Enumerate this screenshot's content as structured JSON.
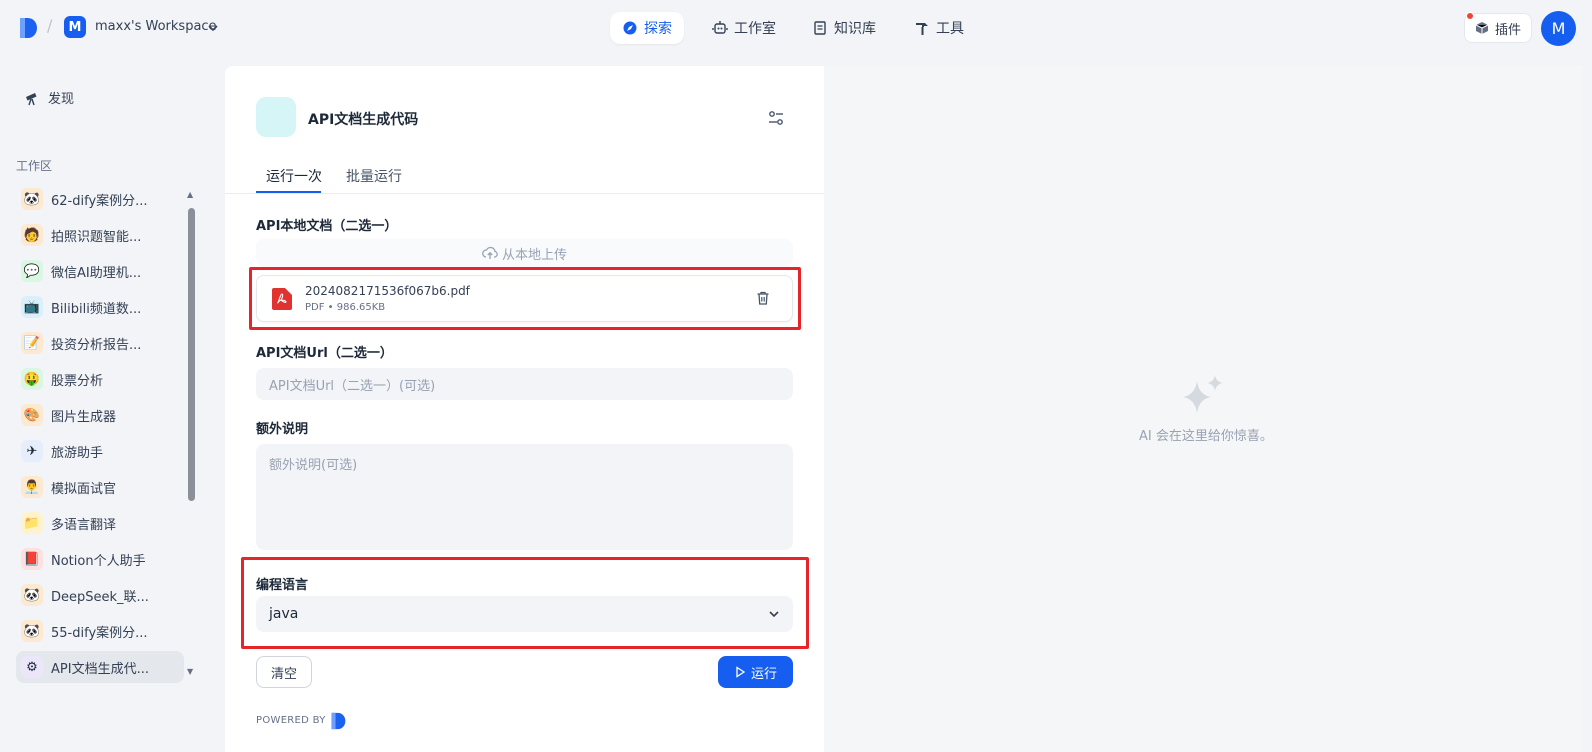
{
  "workspace": {
    "badge": "M",
    "name": "maxx's Workspace",
    "caret": "⌄"
  },
  "nav": {
    "explore": "探索",
    "studio": "工作室",
    "knowledge": "知识库",
    "tools": "工具"
  },
  "header": {
    "plugin_label": "插件",
    "avatar_initial": "M"
  },
  "sidebar": {
    "discover_label": "发现",
    "workspace_label": "工作区",
    "apps": [
      {
        "name": "62-dify案例分...",
        "icon": "panda-icon",
        "bg": "#fde8d0",
        "glyph": "🐼"
      },
      {
        "name": "拍照识题智能...",
        "icon": "student-icon",
        "bg": "#fde8d0",
        "glyph": "🧑"
      },
      {
        "name": "微信AI助理机...",
        "icon": "chat-icon",
        "bg": "#d9f7e1",
        "glyph": "💬"
      },
      {
        "name": "Bilibili频道数...",
        "icon": "tv-icon",
        "bg": "#d9f0fb",
        "glyph": "📺"
      },
      {
        "name": "投资分析报告...",
        "icon": "report-icon",
        "bg": "#fde8d0",
        "glyph": "📝"
      },
      {
        "name": "股票分析",
        "icon": "money-face-icon",
        "bg": "#d9f7e1",
        "glyph": "🤑"
      },
      {
        "name": "图片生成器",
        "icon": "palette-icon",
        "bg": "#fde8d0",
        "glyph": "🎨"
      },
      {
        "name": "旅游助手",
        "icon": "airplane-icon",
        "bg": "#e6eefb",
        "glyph": "✈"
      },
      {
        "name": "模拟面试官",
        "icon": "interview-icon",
        "bg": "#fde8d0",
        "glyph": "👨‍💼"
      },
      {
        "name": "多语言翻译",
        "icon": "folder-icon",
        "bg": "#fff3cc",
        "glyph": "📁"
      },
      {
        "name": "Notion个人助手",
        "icon": "notebook-icon",
        "bg": "#fde0e0",
        "glyph": "📕"
      },
      {
        "name": "DeepSeek_联...",
        "icon": "panda-icon",
        "bg": "#fde8d0",
        "glyph": "🐼"
      },
      {
        "name": "55-dify案例分...",
        "icon": "panda-icon",
        "bg": "#fde8d0",
        "glyph": "🐼"
      },
      {
        "name": "API文档生成代...",
        "icon": "api-gear-icon",
        "bg": "#ece6fb",
        "glyph": "⚙"
      }
    ]
  },
  "app": {
    "title": "API文档生成代码",
    "tabs": {
      "run_once": "运行一次",
      "batch_run": "批量运行"
    }
  },
  "form": {
    "local_doc_label": "API本地文档（二选一）",
    "upload_text": "从本地上传",
    "file": {
      "name": "2024082171536f067b6.pdf",
      "meta": "PDF • 986.65KB"
    },
    "url_label": "API文档Url（二选一）",
    "url_placeholder": "API文档Url（二选一）(可选)",
    "extra_label": "额外说明",
    "extra_placeholder": "额外说明(可选)",
    "lang_label": "编程语言",
    "lang_value": "java",
    "clear_label": "清空",
    "run_label": "运行",
    "powered_by": "POWERED BY"
  },
  "result": {
    "placeholder": "AI 会在这里给你惊喜。"
  },
  "colors": {
    "accent": "#155eef",
    "highlight": "#e5252a",
    "pdf": "#e0322f"
  }
}
